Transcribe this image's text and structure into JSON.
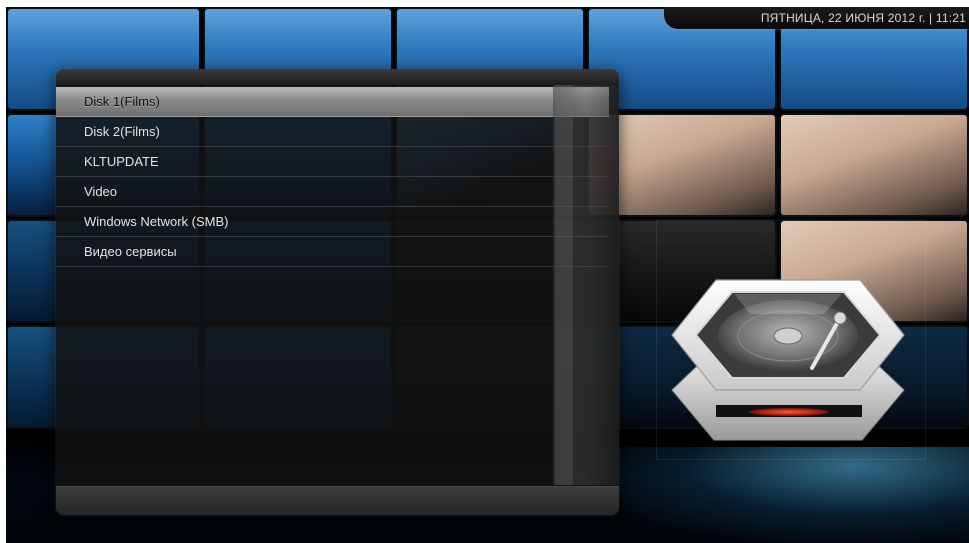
{
  "header": {
    "date_time": "ПЯТНИЦА, 22 ИЮНЯ 2012 г. | 11:21"
  },
  "list": {
    "selected_index": 0,
    "items": [
      {
        "label": "Disk 1(Films)"
      },
      {
        "label": "Disk 2(Films)"
      },
      {
        "label": "KLTUPDATE"
      },
      {
        "label": "Video"
      },
      {
        "label": "Windows Network (SMB)"
      },
      {
        "label": "Видео сервисы"
      }
    ]
  },
  "preview": {
    "icon": "hard-disk-icon",
    "indicator_color": "#e83020"
  },
  "colors": {
    "panel_bg": "#121212",
    "selection": "#9a9a9a",
    "background_accent": "#1a5fa2"
  }
}
